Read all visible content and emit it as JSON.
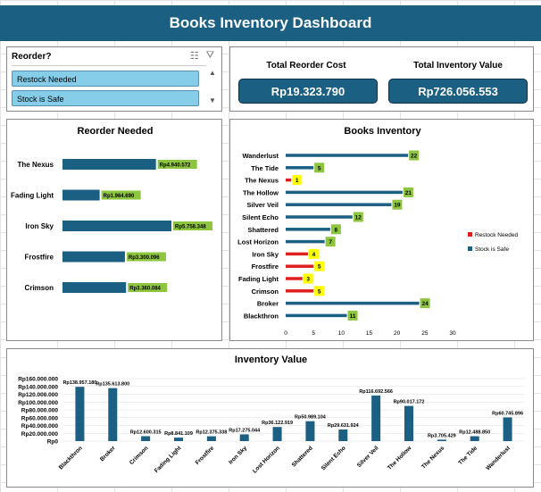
{
  "title": "Books Inventory Dashboard",
  "slicer": {
    "header": "Reorder?",
    "items": [
      "Restock Needed",
      "Stock is Safe"
    ],
    "icons": [
      "multi-select-icon",
      "clear-filter-icon"
    ]
  },
  "kpis": [
    {
      "label": "Total Reorder Cost",
      "value": "Rp19.323.790"
    },
    {
      "label": "Total Inventory Value",
      "value": "Rp726.056.553"
    }
  ],
  "colors": {
    "banner": "#1b5f82",
    "bar": "#1b5f82",
    "restock": "#e01e1e",
    "label_green": "#8ec53f",
    "label_yellow": "#ffff00"
  },
  "chart_data": [
    {
      "id": "reorder",
      "type": "bar",
      "orientation": "horizontal",
      "title": "Reorder Needed",
      "categories": [
        "The Nexus",
        "Fading Light",
        "Iron Sky",
        "Frostfire",
        "Crimson"
      ],
      "values": [
        4940572,
        1964690,
        5758348,
        3300096,
        3360084
      ],
      "data_labels": [
        "Rp4.940.572",
        "Rp1.964.690",
        "Rp5.758.348",
        "Rp3.300.096",
        "Rp3.360.084"
      ]
    },
    {
      "id": "inventory",
      "type": "bar",
      "orientation": "horizontal",
      "title": "Books Inventory",
      "categories": [
        "Wanderlust",
        "The Tide",
        "The Nexus",
        "The Hollow",
        "Silver Veil",
        "Silent Echo",
        "Shattered",
        "Lost Horizon",
        "Iron Sky",
        "Frostfire",
        "Fading Light",
        "Crimson",
        "Broker",
        "Blackthron"
      ],
      "series": [
        {
          "name": "Restock Needed",
          "values": [
            null,
            null,
            1,
            null,
            null,
            null,
            null,
            null,
            4,
            5,
            3,
            5,
            null,
            null
          ]
        },
        {
          "name": "Stock is Safe",
          "values": [
            22,
            5,
            null,
            21,
            19,
            12,
            8,
            7,
            null,
            null,
            null,
            null,
            24,
            11
          ]
        }
      ],
      "xlim": [
        0,
        30
      ],
      "xticks": [
        "0",
        "5",
        "10",
        "15",
        "20",
        "25",
        "30"
      ],
      "legend": "right"
    },
    {
      "id": "value",
      "type": "bar",
      "title": "Inventory Value",
      "categories": [
        "Blackthron",
        "Broker",
        "Crimson",
        "Fading Light",
        "Frostfire",
        "Iron Sky",
        "Lost Horizon",
        "Shattered",
        "Silent Echo",
        "Silver Veil",
        "The Hollow",
        "The Nexus",
        "The Tide",
        "Wanderlust"
      ],
      "values": [
        138957180,
        135613800,
        12600315,
        8841109,
        12375338,
        17275044,
        36122919,
        50989104,
        29631924,
        116692566,
        90017172,
        3705429,
        12488850,
        60745896
      ],
      "data_labels": [
        "Rp138.957.180",
        "Rp135.613.800",
        "Rp12.600.315",
        "Rp8.841.109",
        "Rp12.375.338",
        "Rp17.275.044",
        "Rp36.122.919",
        "Rp50.989.104",
        "Rp29.631.924",
        "Rp116.692.566",
        "Rp90.017.172",
        "Rp3.705.429",
        "Rp12.488.850",
        "Rp60.745.896"
      ],
      "ylim": [
        0,
        160000000
      ],
      "yticks": [
        "Rp0",
        "Rp20.000.000",
        "Rp40.000.000",
        "Rp60.000.000",
        "Rp80.000.000",
        "Rp100.000.000",
        "Rp120.000.000",
        "Rp140.000.000",
        "Rp160.000.000"
      ]
    }
  ]
}
